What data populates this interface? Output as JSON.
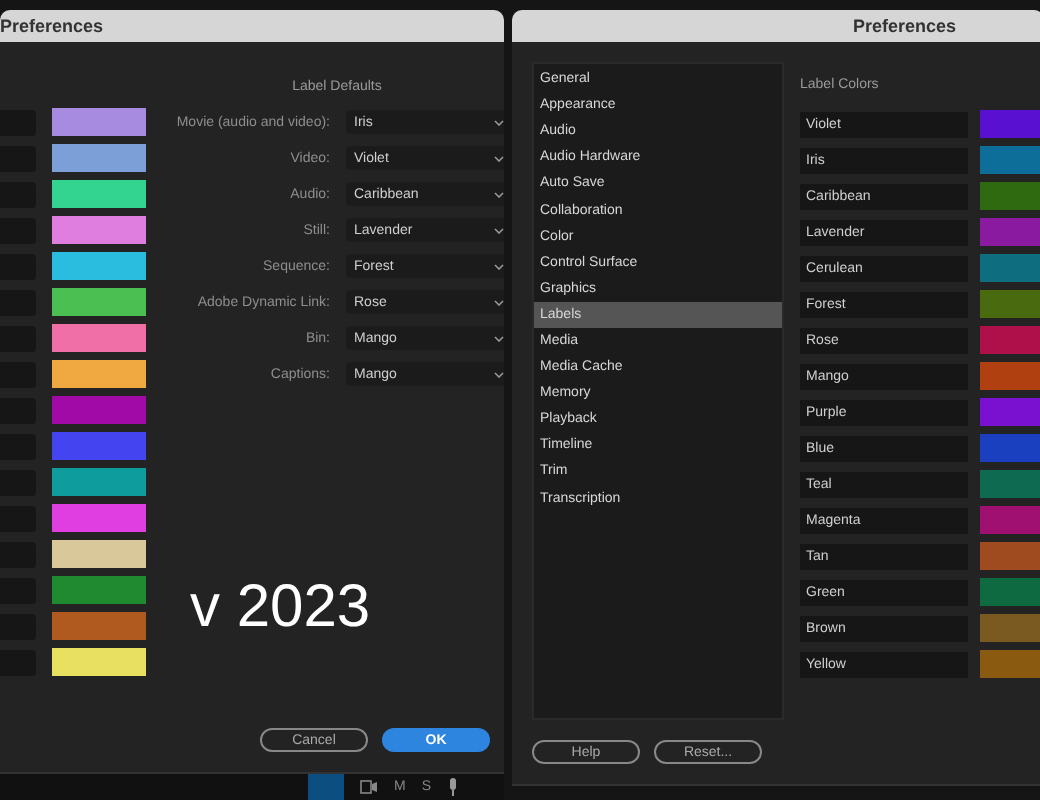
{
  "left_window": {
    "title": "Preferences",
    "swatches": [
      {
        "color": "#a78be0"
      },
      {
        "color": "#7b9fd6"
      },
      {
        "color": "#32d48f"
      },
      {
        "color": "#e07ee0"
      },
      {
        "color": "#2bbde0"
      },
      {
        "color": "#4cbf52"
      },
      {
        "color": "#f06fa6"
      },
      {
        "color": "#f0a940"
      },
      {
        "color": "#a10aa6"
      },
      {
        "color": "#4444f0"
      },
      {
        "color": "#0f9c9c"
      },
      {
        "color": "#e03ee0"
      },
      {
        "color": "#d8c89a"
      },
      {
        "color": "#208a30"
      },
      {
        "color": "#b05a20"
      },
      {
        "color": "#e8e060"
      }
    ],
    "label_defaults": {
      "heading": "Label Defaults",
      "rows": [
        {
          "label": "Movie (audio and video):",
          "value": "Iris"
        },
        {
          "label": "Video:",
          "value": "Violet"
        },
        {
          "label": "Audio:",
          "value": "Caribbean"
        },
        {
          "label": "Still:",
          "value": "Lavender"
        },
        {
          "label": "Sequence:",
          "value": "Forest"
        },
        {
          "label": "Adobe Dynamic Link:",
          "value": "Rose"
        },
        {
          "label": "Bin:",
          "value": "Mango"
        },
        {
          "label": "Captions:",
          "value": "Mango"
        }
      ]
    },
    "annotation": "v 2023",
    "buttons": [
      {
        "label": "Cancel",
        "kind": "secondary"
      },
      {
        "label": "OK",
        "kind": "primary"
      }
    ]
  },
  "track_bar": {
    "buttons": [
      "M",
      "S"
    ]
  },
  "right_window": {
    "title": "Preferences",
    "categories": [
      {
        "label": "General",
        "selected": false
      },
      {
        "label": "Appearance",
        "selected": false
      },
      {
        "label": "Audio",
        "selected": false
      },
      {
        "label": "Audio Hardware",
        "selected": false
      },
      {
        "label": "Auto Save",
        "selected": false
      },
      {
        "label": "Collaboration",
        "selected": false
      },
      {
        "label": "Color",
        "selected": false
      },
      {
        "label": "Control Surface",
        "selected": false
      },
      {
        "label": "Graphics",
        "selected": false
      },
      {
        "label": "Labels",
        "selected": true
      },
      {
        "label": "Media",
        "selected": false
      },
      {
        "label": "Media Cache",
        "selected": false
      },
      {
        "label": "Memory",
        "selected": false
      },
      {
        "label": "Playback",
        "selected": false
      },
      {
        "label": "Timeline",
        "selected": false
      },
      {
        "label": "Trim",
        "selected": false
      },
      {
        "label": "Transcription",
        "selected": false
      }
    ],
    "label_colors": {
      "heading": "Label Colors",
      "items": [
        {
          "name": "Violet",
          "color": "#5a10d0"
        },
        {
          "name": "Iris",
          "color": "#0e6e9a"
        },
        {
          "name": "Caribbean",
          "color": "#2f6a10"
        },
        {
          "name": "Lavender",
          "color": "#8a1aa0"
        },
        {
          "name": "Cerulean",
          "color": "#0e6e80"
        },
        {
          "name": "Forest",
          "color": "#4a6a10"
        },
        {
          "name": "Rose",
          "color": "#b0104a"
        },
        {
          "name": "Mango",
          "color": "#b04010"
        },
        {
          "name": "Purple",
          "color": "#7a10d0"
        },
        {
          "name": "Blue",
          "color": "#1a40c0"
        },
        {
          "name": "Teal",
          "color": "#0e6a50"
        },
        {
          "name": "Magenta",
          "color": "#a01070"
        },
        {
          "name": "Tan",
          "color": "#a04a20"
        },
        {
          "name": "Green",
          "color": "#0e6a40"
        },
        {
          "name": "Brown",
          "color": "#7a5a20"
        },
        {
          "name": "Yellow",
          "color": "#8a5a10"
        }
      ]
    },
    "buttons": [
      "Help",
      "Reset..."
    ]
  }
}
